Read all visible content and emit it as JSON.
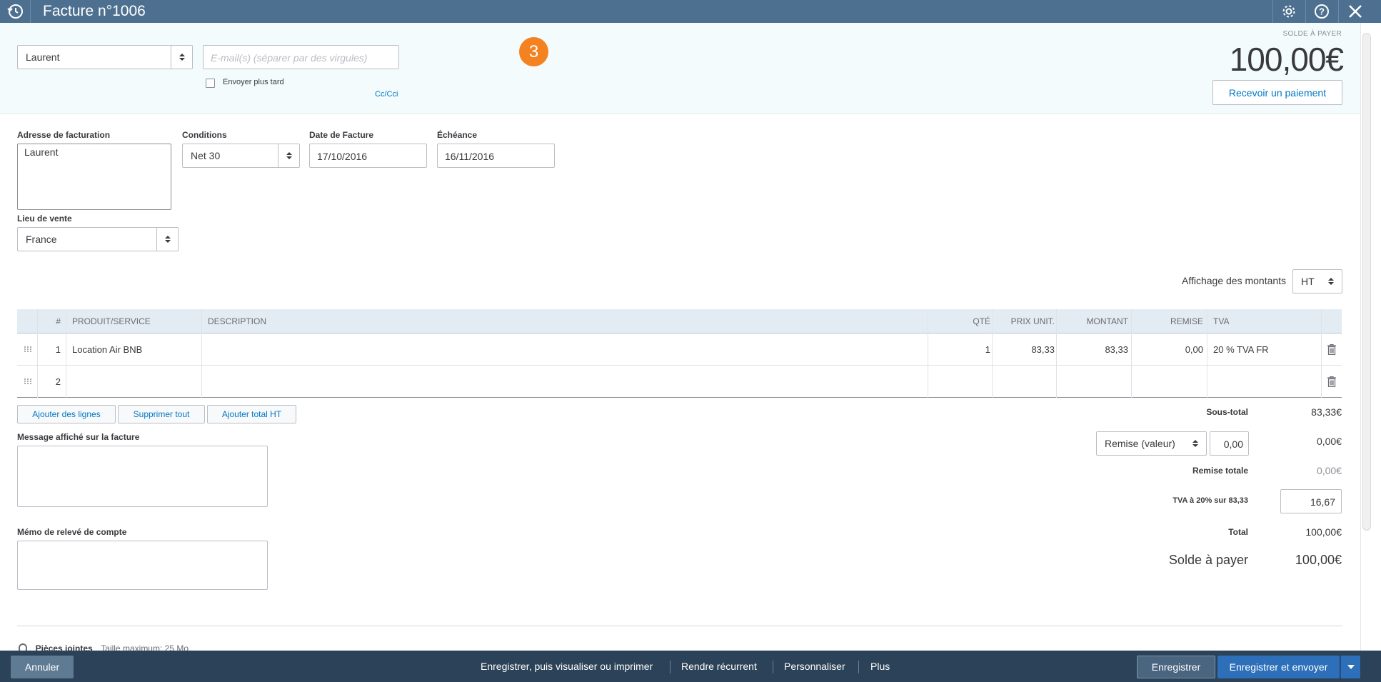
{
  "titlebar": {
    "title": "Facture n°1006",
    "icons": [
      "history-icon",
      "gear-icon",
      "help-icon",
      "close-icon"
    ]
  },
  "header": {
    "customer": "Laurent",
    "email_placeholder": "E-mail(s) (séparer par des virgules)",
    "send_later_label": "Envoyer plus tard",
    "cc_label": "Cc/Cci",
    "step_badge": "3",
    "balance_label": "SOLDE À PAYER",
    "balance_amount": "100,00€",
    "receive_payment": "Recevoir un paiement"
  },
  "details": {
    "billing_address_label": "Adresse de facturation",
    "billing_address": "Laurent",
    "terms_label": "Conditions",
    "terms": "Net 30",
    "invoice_date_label": "Date de Facture",
    "invoice_date": "17/10/2016",
    "due_date_label": "Échéance",
    "due_date": "16/11/2016",
    "place_of_sale_label": "Lieu de vente",
    "place_of_sale": "France",
    "amounts_display_label": "Affichage des montants",
    "amounts_display": "HT"
  },
  "table": {
    "headers": {
      "num": "#",
      "product": "PRODUIT/SERVICE",
      "description": "DESCRIPTION",
      "qty": "QTÉ",
      "unit_price": "PRIX UNIT.",
      "amount": "MONTANT",
      "discount": "REMISE",
      "vat": "TVA"
    },
    "rows": [
      {
        "num": "1",
        "product": "Location Air BNB",
        "description": "",
        "qty": "1",
        "unit_price": "83,33",
        "amount": "83,33",
        "discount": "0,00",
        "vat": "20 % TVA FR"
      },
      {
        "num": "2",
        "product": "",
        "description": "",
        "qty": "",
        "unit_price": "",
        "amount": "",
        "discount": "",
        "vat": ""
      }
    ]
  },
  "table_actions": {
    "add_lines": "Ajouter des lignes",
    "delete_all": "Supprimer tout",
    "add_subtotal": "Ajouter total HT"
  },
  "message": {
    "invoice_message_label": "Message affiché sur la facture",
    "statement_memo_label": "Mémo de relevé de compte",
    "attachments_label": "Pièces jointes",
    "attachments_hint": "Taille maximum: 25 Mo"
  },
  "totals": {
    "subtotal_label": "Sous-total",
    "subtotal": "83,33€",
    "discount_type": "Remise (valeur)",
    "discount_input": "0,00",
    "discount_value": "0,00€",
    "total_discount_label": "Remise totale",
    "total_discount": "0,00€",
    "vat_label": "TVA à 20% sur 83,33",
    "vat_value": "16,67",
    "total_label": "Total",
    "total": "100,00€",
    "balance_label": "Solde à payer",
    "balance": "100,00€"
  },
  "footer": {
    "cancel": "Annuler",
    "save_and_print": "Enregistrer, puis visualiser ou imprimer",
    "make_recurring": "Rendre récurrent",
    "customize": "Personnaliser",
    "more": "Plus",
    "save": "Enregistrer",
    "save_and_send": "Enregistrer et envoyer"
  },
  "colors": {
    "titlebar": "#4d7090",
    "footer": "#2b4258",
    "accent": "#0077c5",
    "badge": "#f58220",
    "primary_button": "#2d6fb9"
  }
}
